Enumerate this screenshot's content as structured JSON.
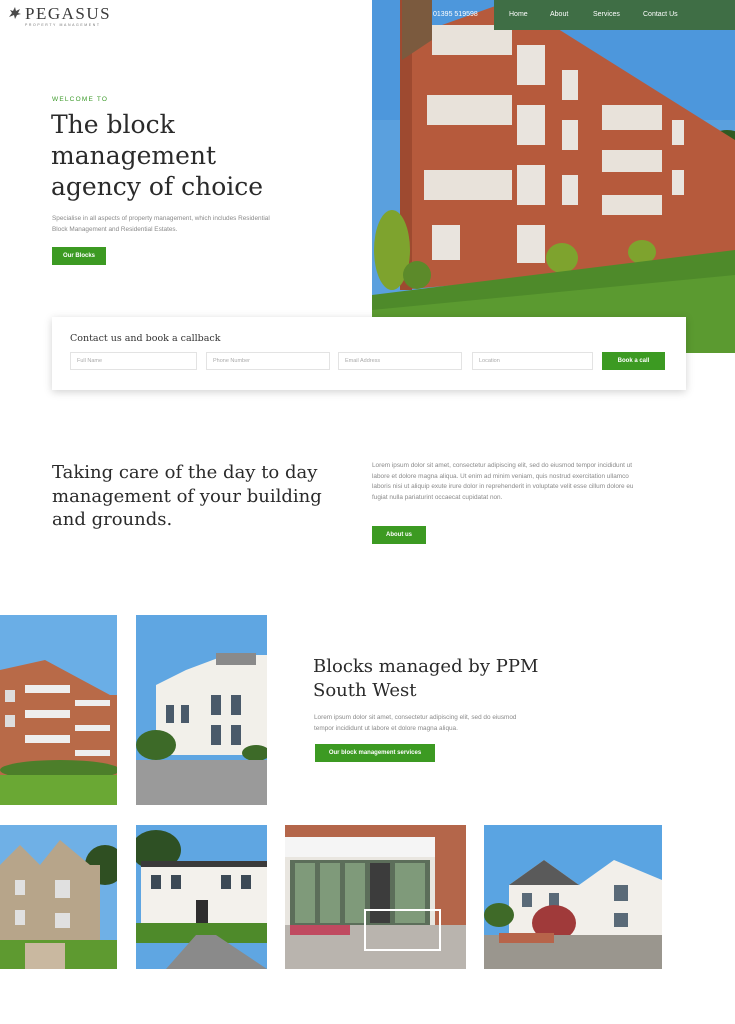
{
  "header": {
    "brand": "PEGASUS",
    "brand_sub": "PROPERTY MANAGEMENT",
    "phone": "01395 519598",
    "nav": [
      "Home",
      "About",
      "Services",
      "Contact Us"
    ]
  },
  "hero": {
    "eyebrow": "WELCOME TO",
    "title_lines": [
      "The block",
      "management",
      "agency of choice"
    ],
    "description": "Specialise in all aspects of property management, which includes Residential Block Management and Residential Estates.",
    "button": "Our Blocks"
  },
  "contact": {
    "title": "Contact us and book a callback",
    "fields": [
      "Full Name",
      "Phone Number",
      "Email Address",
      "Location"
    ],
    "button": "Book a call"
  },
  "about": {
    "title_lines": [
      "Taking care of the day to day",
      "management of your building",
      "and grounds."
    ],
    "text": "Lorem ipsum dolor sit amet, consectetur adipiscing elit, sed do eiusmod tempor incididunt ut labore et dolore magna aliqua. Ut enim ad minim veniam, quis nostrud exercitation ullamco laboris nisi ut aliquip exute irure dolor in reprehenderit in voluptate velit esse cillum dolore eu fugiat nulla pariaturint occaecat cupidatat non.",
    "button": "About us"
  },
  "blocks": {
    "title_lines": [
      "Blocks managed by PPM",
      "South West"
    ],
    "text": "Lorem ipsum dolor sit amet, consectetur adipiscing elit, sed do eiusmod tempor incididunt ut labore et dolore magna aliqua.",
    "button": "Our block management services"
  },
  "colors": {
    "accent": "#3c9a22",
    "nav": "#3f6e45"
  }
}
